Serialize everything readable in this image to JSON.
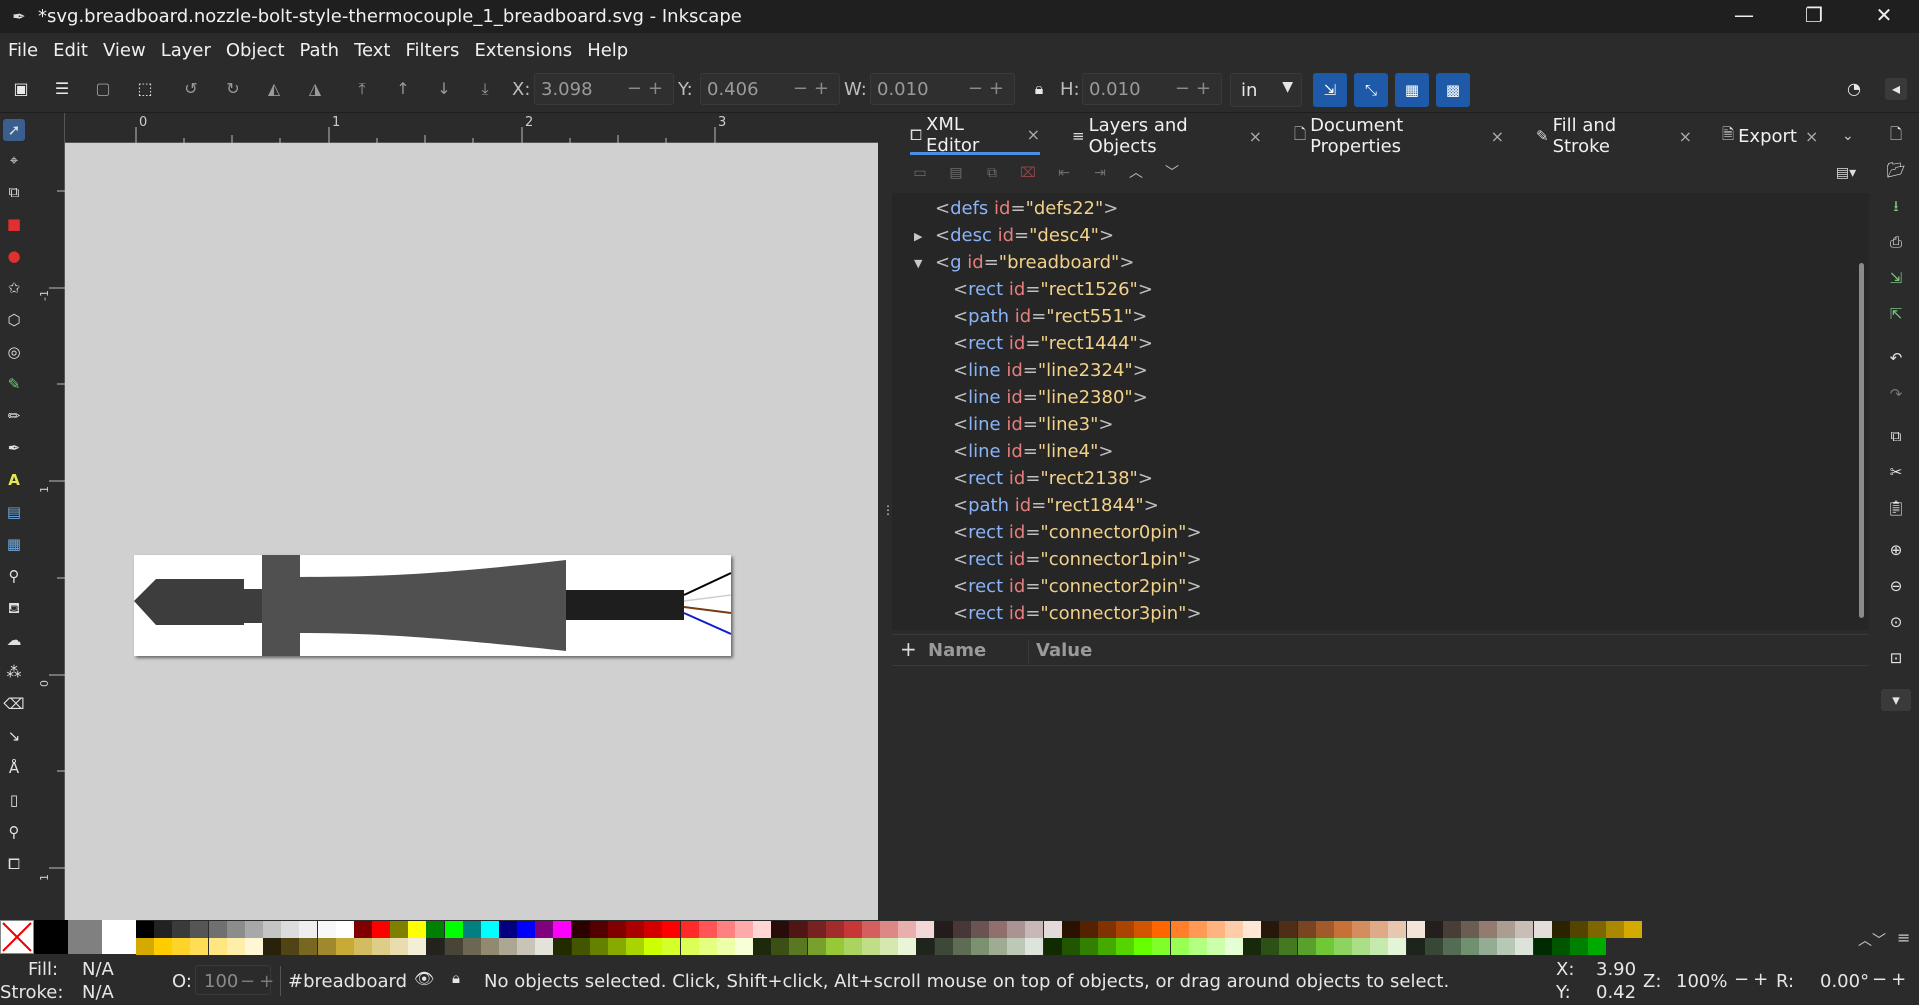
{
  "window": {
    "title": "*svg.breadboard.nozzle-bolt-style-thermocouple_1_breadboard.svg - Inkscape",
    "minimize": "—",
    "maximize": "❐",
    "close": "✕"
  },
  "menu": [
    "File",
    "Edit",
    "View",
    "Layer",
    "Object",
    "Path",
    "Text",
    "Filters",
    "Extensions",
    "Help"
  ],
  "controls": {
    "x_label": "X:",
    "x_value": "3.098",
    "y_label": "Y:",
    "y_value": "0.406",
    "w_label": "W:",
    "w_value": "0.010",
    "h_label": "H:",
    "h_value": "0.010",
    "unit": "in"
  },
  "ruler": {
    "h_ticks": [
      "0",
      "1",
      "2",
      "3"
    ],
    "v_ticks": [
      "-1",
      "1",
      "0",
      "1"
    ]
  },
  "dock": {
    "tabs": [
      {
        "label": "XML Editor",
        "icon": "xml-icon",
        "active": true
      },
      {
        "label": "Layers and Objects",
        "icon": "layers-icon",
        "active": false
      },
      {
        "label": "Document Properties",
        "icon": "document-icon",
        "active": false
      },
      {
        "label": "Fill and Stroke",
        "icon": "brush-icon",
        "active": false
      },
      {
        "label": "Export",
        "icon": "export-icon",
        "active": false
      }
    ]
  },
  "xml": {
    "nodes": [
      {
        "tag": "defs",
        "id": "defs22",
        "depth": 0,
        "expander": ""
      },
      {
        "tag": "desc",
        "id": "desc4",
        "depth": 0,
        "expander": "collapsed"
      },
      {
        "tag": "g",
        "id": "breadboard",
        "depth": 0,
        "expander": "expanded"
      },
      {
        "tag": "rect",
        "id": "rect1526",
        "depth": 1,
        "expander": ""
      },
      {
        "tag": "path",
        "id": "rect551",
        "depth": 1,
        "expander": ""
      },
      {
        "tag": "rect",
        "id": "rect1444",
        "depth": 1,
        "expander": ""
      },
      {
        "tag": "line",
        "id": "line2324",
        "depth": 1,
        "expander": ""
      },
      {
        "tag": "line",
        "id": "line2380",
        "depth": 1,
        "expander": ""
      },
      {
        "tag": "line",
        "id": "line3",
        "depth": 1,
        "expander": ""
      },
      {
        "tag": "line",
        "id": "line4",
        "depth": 1,
        "expander": ""
      },
      {
        "tag": "rect",
        "id": "rect2138",
        "depth": 1,
        "expander": ""
      },
      {
        "tag": "path",
        "id": "rect1844",
        "depth": 1,
        "expander": ""
      },
      {
        "tag": "rect",
        "id": "connector0pin",
        "depth": 1,
        "expander": ""
      },
      {
        "tag": "rect",
        "id": "connector1pin",
        "depth": 1,
        "expander": ""
      },
      {
        "tag": "rect",
        "id": "connector2pin",
        "depth": 1,
        "expander": ""
      },
      {
        "tag": "rect",
        "id": "connector3pin",
        "depth": 1,
        "expander": ""
      }
    ],
    "attr_name_header": "Name",
    "attr_value_header": "Value",
    "add_attr": "+"
  },
  "palette": {
    "top_row": [
      "#000000",
      "#222222",
      "#3a3a3a",
      "#555555",
      "#707070",
      "#8c8c8c",
      "#a8a8a8",
      "#c4c4c4",
      "#dcdcdc",
      "#eeeeee",
      "#f8f8f8",
      "#ffffff",
      "#800000",
      "#ff0000",
      "#808000",
      "#ffff00",
      "#008000",
      "#00ff00",
      "#008080",
      "#00ffff",
      "#000080",
      "#0000ff",
      "#800080",
      "#ff00ff",
      "#2b0000",
      "#550000",
      "#800000",
      "#aa0000",
      "#d40000",
      "#ff0000",
      "#ff2a2a",
      "#ff5555",
      "#ff8080",
      "#ffaaaa",
      "#ffd5d5",
      "#280b0b",
      "#501616",
      "#782121",
      "#a02c2c",
      "#c83737",
      "#d35f5f",
      "#de8787",
      "#e9afaf",
      "#f4d7d7",
      "#241c1c",
      "#483737",
      "#6c5353",
      "#916f6f",
      "#ac9393",
      "#c8b7b7",
      "#e3dbdb",
      "#2b1100",
      "#552200",
      "#803300",
      "#aa4400",
      "#d45500",
      "#ff6600",
      "#ff7f2a",
      "#ff9955",
      "#ffb380",
      "#ffccaa",
      "#ffe6d5",
      "#28170b",
      "#502d16",
      "#784421",
      "#a05a2c",
      "#c87137",
      "#d38d5f",
      "#deaa87",
      "#e9c6af",
      "#f4e3d7",
      "#241f1c",
      "#483e37",
      "#6c5d53",
      "#917c6f",
      "#ac9d93",
      "#c8beb7",
      "#e3dedb",
      "#2b2200",
      "#554400",
      "#806600",
      "#aa8800",
      "#d4aa00"
    ],
    "bottom_row": [
      "#d4aa00",
      "#ffcc00",
      "#ffd42a",
      "#ffdd55",
      "#ffe680",
      "#ffeeaa",
      "#fff6d5",
      "#28220b",
      "#504416",
      "#786721",
      "#a0892c",
      "#c8ab37",
      "#d3bc5f",
      "#decd87",
      "#e9ddaf",
      "#f4eed7",
      "#24221c",
      "#484537",
      "#6c6753",
      "#918a6f",
      "#aca793",
      "#c8c4b7",
      "#e3e2db",
      "#222b00",
      "#445500",
      "#668000",
      "#88aa00",
      "#aad400",
      "#ccff00",
      "#d4ff2a",
      "#ddff55",
      "#e5ff80",
      "#eeffaa",
      "#f6ffd5",
      "#1e280b",
      "#3c5016",
      "#5a7821",
      "#78a02c",
      "#96c837",
      "#abd35f",
      "#c0de87",
      "#d5e9af",
      "#eaf4d7",
      "#1f241c",
      "#3e4837",
      "#5d6c53",
      "#7c916f",
      "#9dac93",
      "#bec8b7",
      "#dee3db",
      "#112b00",
      "#225500",
      "#338000",
      "#44aa00",
      "#55d400",
      "#66ff00",
      "#7fff2a",
      "#99ff55",
      "#b3ff80",
      "#ccffaa",
      "#e5ffd5",
      "#17280b",
      "#2d5016",
      "#447821",
      "#5aa02c",
      "#71c837",
      "#8dd35f",
      "#aade87",
      "#c6e9af",
      "#e3f4d7",
      "#1c241c",
      "#374837",
      "#536c53",
      "#6f916f",
      "#93ac93",
      "#b7c8b7",
      "#dbe3db",
      "#002b00",
      "#005500",
      "#008000",
      "#00aa00"
    ]
  },
  "status": {
    "fill_label": "Fill:",
    "fill_value": "N/A",
    "stroke_label": "Stroke:",
    "stroke_value": "N/A",
    "opacity_label": "O:",
    "opacity_value": "100",
    "layer": "#breadboard",
    "message": "No objects selected. Click, Shift+click, Alt+scroll mouse on top of objects, or drag around objects to select.",
    "x_label": "X:",
    "x_value": "3.90",
    "y_label": "Y:",
    "y_value": "0.42",
    "zoom_label": "Z:",
    "zoom_value": "100%",
    "rotate_label": "R:",
    "rotate_value": "0.00°"
  }
}
